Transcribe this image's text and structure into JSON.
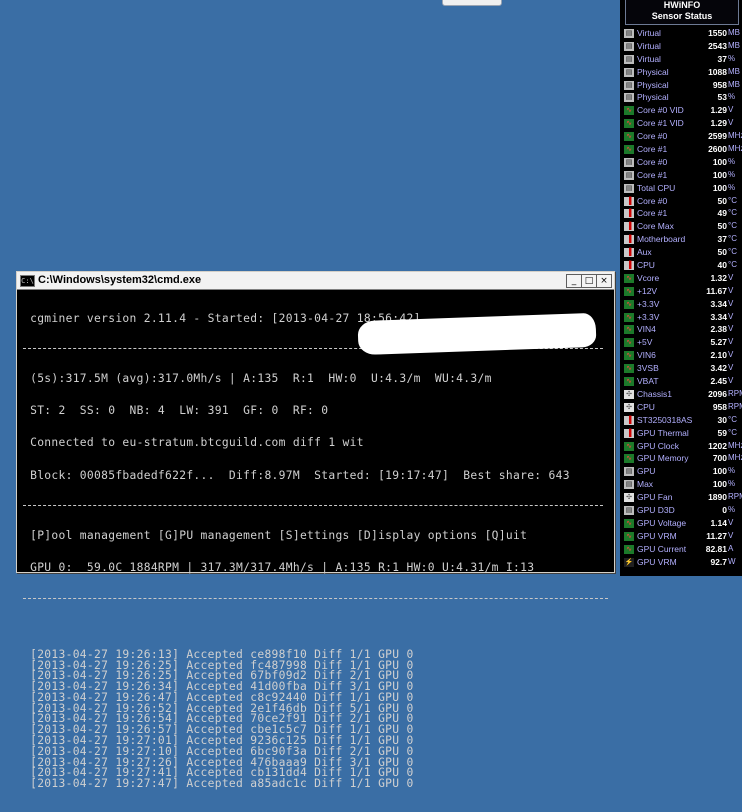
{
  "hwinfo": {
    "title_line1": "HWiNFO",
    "title_line2": "Sensor Status",
    "sensors": [
      {
        "icon": "chip",
        "label": "Virtual",
        "value": "1550",
        "unit": "MB"
      },
      {
        "icon": "chip",
        "label": "Virtual",
        "value": "2543",
        "unit": "MB"
      },
      {
        "icon": "chip",
        "label": "Virtual",
        "value": "37",
        "unit": "%"
      },
      {
        "icon": "chip",
        "label": "Physical",
        "value": "1088",
        "unit": "MB"
      },
      {
        "icon": "chip",
        "label": "Physical",
        "value": "958",
        "unit": "MB"
      },
      {
        "icon": "chip",
        "label": "Physical",
        "value": "53",
        "unit": "%"
      },
      {
        "icon": "green",
        "label": "Core #0 VID",
        "value": "1.29",
        "unit": "V"
      },
      {
        "icon": "green",
        "label": "Core #1 VID",
        "value": "1.29",
        "unit": "V"
      },
      {
        "icon": "green",
        "label": "Core #0",
        "value": "2599",
        "unit": "MHz"
      },
      {
        "icon": "green",
        "label": "Core #1",
        "value": "2600",
        "unit": "MHz"
      },
      {
        "icon": "chip",
        "label": "Core #0",
        "value": "100",
        "unit": "%"
      },
      {
        "icon": "chip",
        "label": "Core #1",
        "value": "100",
        "unit": "%"
      },
      {
        "icon": "chip",
        "label": "Total CPU",
        "value": "100",
        "unit": "%"
      },
      {
        "icon": "red",
        "label": "Core #0",
        "value": "50",
        "unit": "°C"
      },
      {
        "icon": "red",
        "label": "Core #1",
        "value": "49",
        "unit": "°C"
      },
      {
        "icon": "red",
        "label": "Core Max",
        "value": "50",
        "unit": "°C"
      },
      {
        "icon": "red",
        "label": "Motherboard",
        "value": "37",
        "unit": "°C"
      },
      {
        "icon": "red",
        "label": "Aux",
        "value": "50",
        "unit": "°C"
      },
      {
        "icon": "red",
        "label": "CPU",
        "value": "40",
        "unit": "°C"
      },
      {
        "icon": "green",
        "label": "Vcore",
        "value": "1.32",
        "unit": "V"
      },
      {
        "icon": "green",
        "label": "+12V",
        "value": "11.67",
        "unit": "V"
      },
      {
        "icon": "green",
        "label": "+3.3V",
        "value": "3.34",
        "unit": "V"
      },
      {
        "icon": "green",
        "label": "+3.3V",
        "value": "3.34",
        "unit": "V"
      },
      {
        "icon": "green",
        "label": "VIN4",
        "value": "2.38",
        "unit": "V"
      },
      {
        "icon": "green",
        "label": "+5V",
        "value": "5.27",
        "unit": "V"
      },
      {
        "icon": "green",
        "label": "VIN6",
        "value": "2.10",
        "unit": "V"
      },
      {
        "icon": "green",
        "label": "3VSB",
        "value": "3.42",
        "unit": "V"
      },
      {
        "icon": "green",
        "label": "VBAT",
        "value": "2.45",
        "unit": "V"
      },
      {
        "icon": "fan",
        "label": "Chassis1",
        "value": "2096",
        "unit": "RPM"
      },
      {
        "icon": "fan",
        "label": "CPU",
        "value": "958",
        "unit": "RPM"
      },
      {
        "icon": "red",
        "label": "ST3250318AS",
        "value": "30",
        "unit": "°C"
      },
      {
        "icon": "red",
        "label": "GPU Thermal",
        "value": "59",
        "unit": "°C"
      },
      {
        "icon": "green",
        "label": "GPU Clock",
        "value": "1202",
        "unit": "MHz"
      },
      {
        "icon": "green",
        "label": "GPU Memory",
        "value": "700",
        "unit": "MHz"
      },
      {
        "icon": "chip",
        "label": "GPU",
        "value": "100",
        "unit": "%"
      },
      {
        "icon": "chip",
        "label": "Max",
        "value": "100",
        "unit": "%"
      },
      {
        "icon": "fan",
        "label": "GPU Fan",
        "value": "1890",
        "unit": "RPM"
      },
      {
        "icon": "chip",
        "label": "GPU D3D",
        "value": "0",
        "unit": "%"
      },
      {
        "icon": "green",
        "label": "GPU Voltage",
        "value": "1.14",
        "unit": "V"
      },
      {
        "icon": "green",
        "label": "GPU VRM",
        "value": "11.27",
        "unit": "V"
      },
      {
        "icon": "green",
        "label": "GPU Current",
        "value": "82.81",
        "unit": "A"
      },
      {
        "icon": "bolt",
        "label": "GPU VRM",
        "value": "92.7",
        "unit": "W"
      }
    ]
  },
  "cmd": {
    "title": "C:\\Windows\\system32\\cmd.exe",
    "min_glyph": "_",
    "max_glyph": "□",
    "close_glyph": "×",
    "header": " cgminer version 2.11.4 - Started: [2013-04-27 18:56:42]",
    "status": [
      " (5s):317.5M (avg):317.0Mh/s | A:135  R:1  HW:0  U:4.3/m  WU:4.3/m",
      " ST: 2  SS: 0  NB: 4  LW: 391  GF: 0  RF: 0",
      " Connected to eu-stratum.btcguild.com diff 1 wit",
      " Block: 00085fbadedf622f...  Diff:8.97M  Started: [19:17:47]  Best share: 643"
    ],
    "menu": " [P]ool management [G]PU management [S]ettings [D]isplay options [Q]uit",
    "gpu": " GPU 0:  59.0C 1884RPM | 317.3M/317.4Mh/s | A:135 R:1 HW:0 U:4.31/m I:13",
    "log": [
      " [2013-04-27 19:26:13] Accepted ce898f10 Diff 1/1 GPU 0",
      " [2013-04-27 19:26:25] Accepted fc487998 Diff 1/1 GPU 0",
      " [2013-04-27 19:26:25] Accepted 67bf09d2 Diff 2/1 GPU 0",
      " [2013-04-27 19:26:34] Accepted 41d00fba Diff 3/1 GPU 0",
      " [2013-04-27 19:26:47] Accepted c8c92440 Diff 1/1 GPU 0",
      " [2013-04-27 19:26:52] Accepted 2e1f46db Diff 5/1 GPU 0",
      " [2013-04-27 19:26:54] Accepted 70ce2f91 Diff 2/1 GPU 0",
      " [2013-04-27 19:26:57] Accepted cbe1c5c7 Diff 1/1 GPU 0",
      " [2013-04-27 19:27:01] Accepted 9236c125 Diff 1/1 GPU 0",
      " [2013-04-27 19:27:10] Accepted 6bc90f3a Diff 2/1 GPU 0",
      " [2013-04-27 19:27:26] Accepted 476baaa9 Diff 3/1 GPU 0",
      " [2013-04-27 19:27:41] Accepted cb131dd4 Diff 1/1 GPU 0",
      " [2013-04-27 19:27:47] Accepted a85adc1c Diff 1/1 GPU 0"
    ]
  }
}
